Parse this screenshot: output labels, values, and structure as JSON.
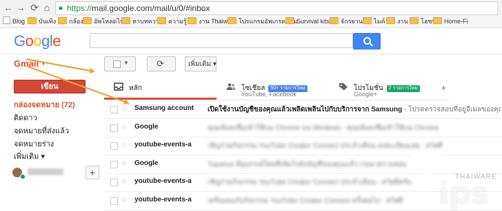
{
  "browser": {
    "url_protocol": "https://",
    "url_rest": "mail.google.com/mail/u/0/#inbox"
  },
  "bookmarks": [
    {
      "label": "Blog",
      "icon": "google-doc-icon"
    },
    {
      "label": "บันเทิง",
      "icon": "folder-icon"
    },
    {
      "label": "กล้อง",
      "icon": "folder-icon"
    },
    {
      "label": "อัพโหลดไฟล์",
      "icon": "folder-icon"
    },
    {
      "label": "หาบทความ",
      "icon": "folder-icon"
    },
    {
      "label": "ความรู้",
      "icon": "folder-icon"
    },
    {
      "label": "งาน Thaiware",
      "icon": "folder-icon"
    },
    {
      "label": "โปรแกรมอัพเกรดคอม",
      "icon": "folder-icon"
    },
    {
      "label": "Survival kits",
      "icon": "folder-icon"
    },
    {
      "label": "จักรยาน",
      "icon": "folder-icon"
    },
    {
      "label": "ไมค์",
      "icon": "folder-icon"
    },
    {
      "label": "งาน",
      "icon": "folder-icon"
    },
    {
      "label": "โฮชน",
      "icon": "folder-icon"
    },
    {
      "label": "Home-Fi",
      "icon": "folder-icon"
    }
  ],
  "header": {
    "logo_letters": [
      "G",
      "o",
      "o",
      "g",
      "l",
      "e"
    ],
    "logo_colors": [
      "#4285f4",
      "#ea4335",
      "#fbbc05",
      "#4285f4",
      "#34a853",
      "#ea4335"
    ]
  },
  "sidebar": {
    "app_label": "Gmail",
    "compose_label": "เขียน",
    "items": [
      {
        "label": "กล่องจดหมาย (72)",
        "active": true
      },
      {
        "label": "ติดดาว"
      },
      {
        "label": "จดหมายที่ส่งแล้ว"
      },
      {
        "label": "จดหมายร่าง"
      },
      {
        "label": "เพิ่มเติม ▾"
      }
    ],
    "hangouts_add": "+"
  },
  "toolbar": {
    "more_label": "เพิ่มเติม ▾",
    "refresh_glyph": "⟳"
  },
  "tabs": [
    {
      "label": "หลัก",
      "sub": "",
      "badge": "",
      "icon": "inbox-icon"
    },
    {
      "label": "โซเชียล",
      "sub": "YouTube, Facebook",
      "badge": "50+ รายการใหม่",
      "badge_color": "#4a86e8",
      "icon": "people-icon"
    },
    {
      "label": "โปรโมชั่น",
      "sub": "Google+",
      "badge": "2 รายการใหม่",
      "badge_color": "#16a765",
      "icon": "tag-icon"
    }
  ],
  "tab_add": "+",
  "emails": [
    {
      "sender": "Samsung account",
      "subject": "เปิดใช้งานบัญชีของคุณแล้วเพลิดเพลินไปกับบริการจาก Samsung",
      "preview": " - โปรดตรวจสอบที่อยู่อีเมลของคุณ",
      "blurred": false
    },
    {
      "sender": "Google",
      "subject": "",
      "preview": "คุณเพิ่งลงชื่อเข้าใช้บน Chrome บน Windows - คุณเพิ่งลงชื่อเข้าใช้บน Chrome",
      "blurred": true
    },
    {
      "sender": "youtube-events-a",
      "subject": "",
      "preview": "เชิญร่วมกิจกรรม YouTube Creator Connect ประจำเดือน ลงทะเบียนเลย - สวัสดี",
      "blurred": true
    },
    {
      "sender": "Google",
      "subject": "",
      "preview": "Tupanus มีอุปกรณ์ใหม่ที่เพิ่มไปยังบัญชีของคุณแล้ว กรุณาตรวจสอบ",
      "blurred": true
    },
    {
      "sender": "youtube-events-a",
      "subject": "",
      "preview": "เชิญร่วมกิจกรรม YouTube Creator Connect ประจำเดือน - สวัสดีครับ",
      "blurred": true
    },
    {
      "sender": "youtube-events-a",
      "subject": "",
      "preview": "เตรียมพบกับกิจกรรม YouTube Creator Connect ครั้งต่อไป - สวัสดี",
      "blurred": true
    }
  ],
  "watermark": {
    "brand": "THAIWARE",
    "t": "T",
    "ips": "ips"
  },
  "colors": {
    "annotation_arrow": "#f0a030",
    "compose": "#d14836",
    "accent_red": "#dd4b39",
    "search_blue": "#4285f4"
  }
}
